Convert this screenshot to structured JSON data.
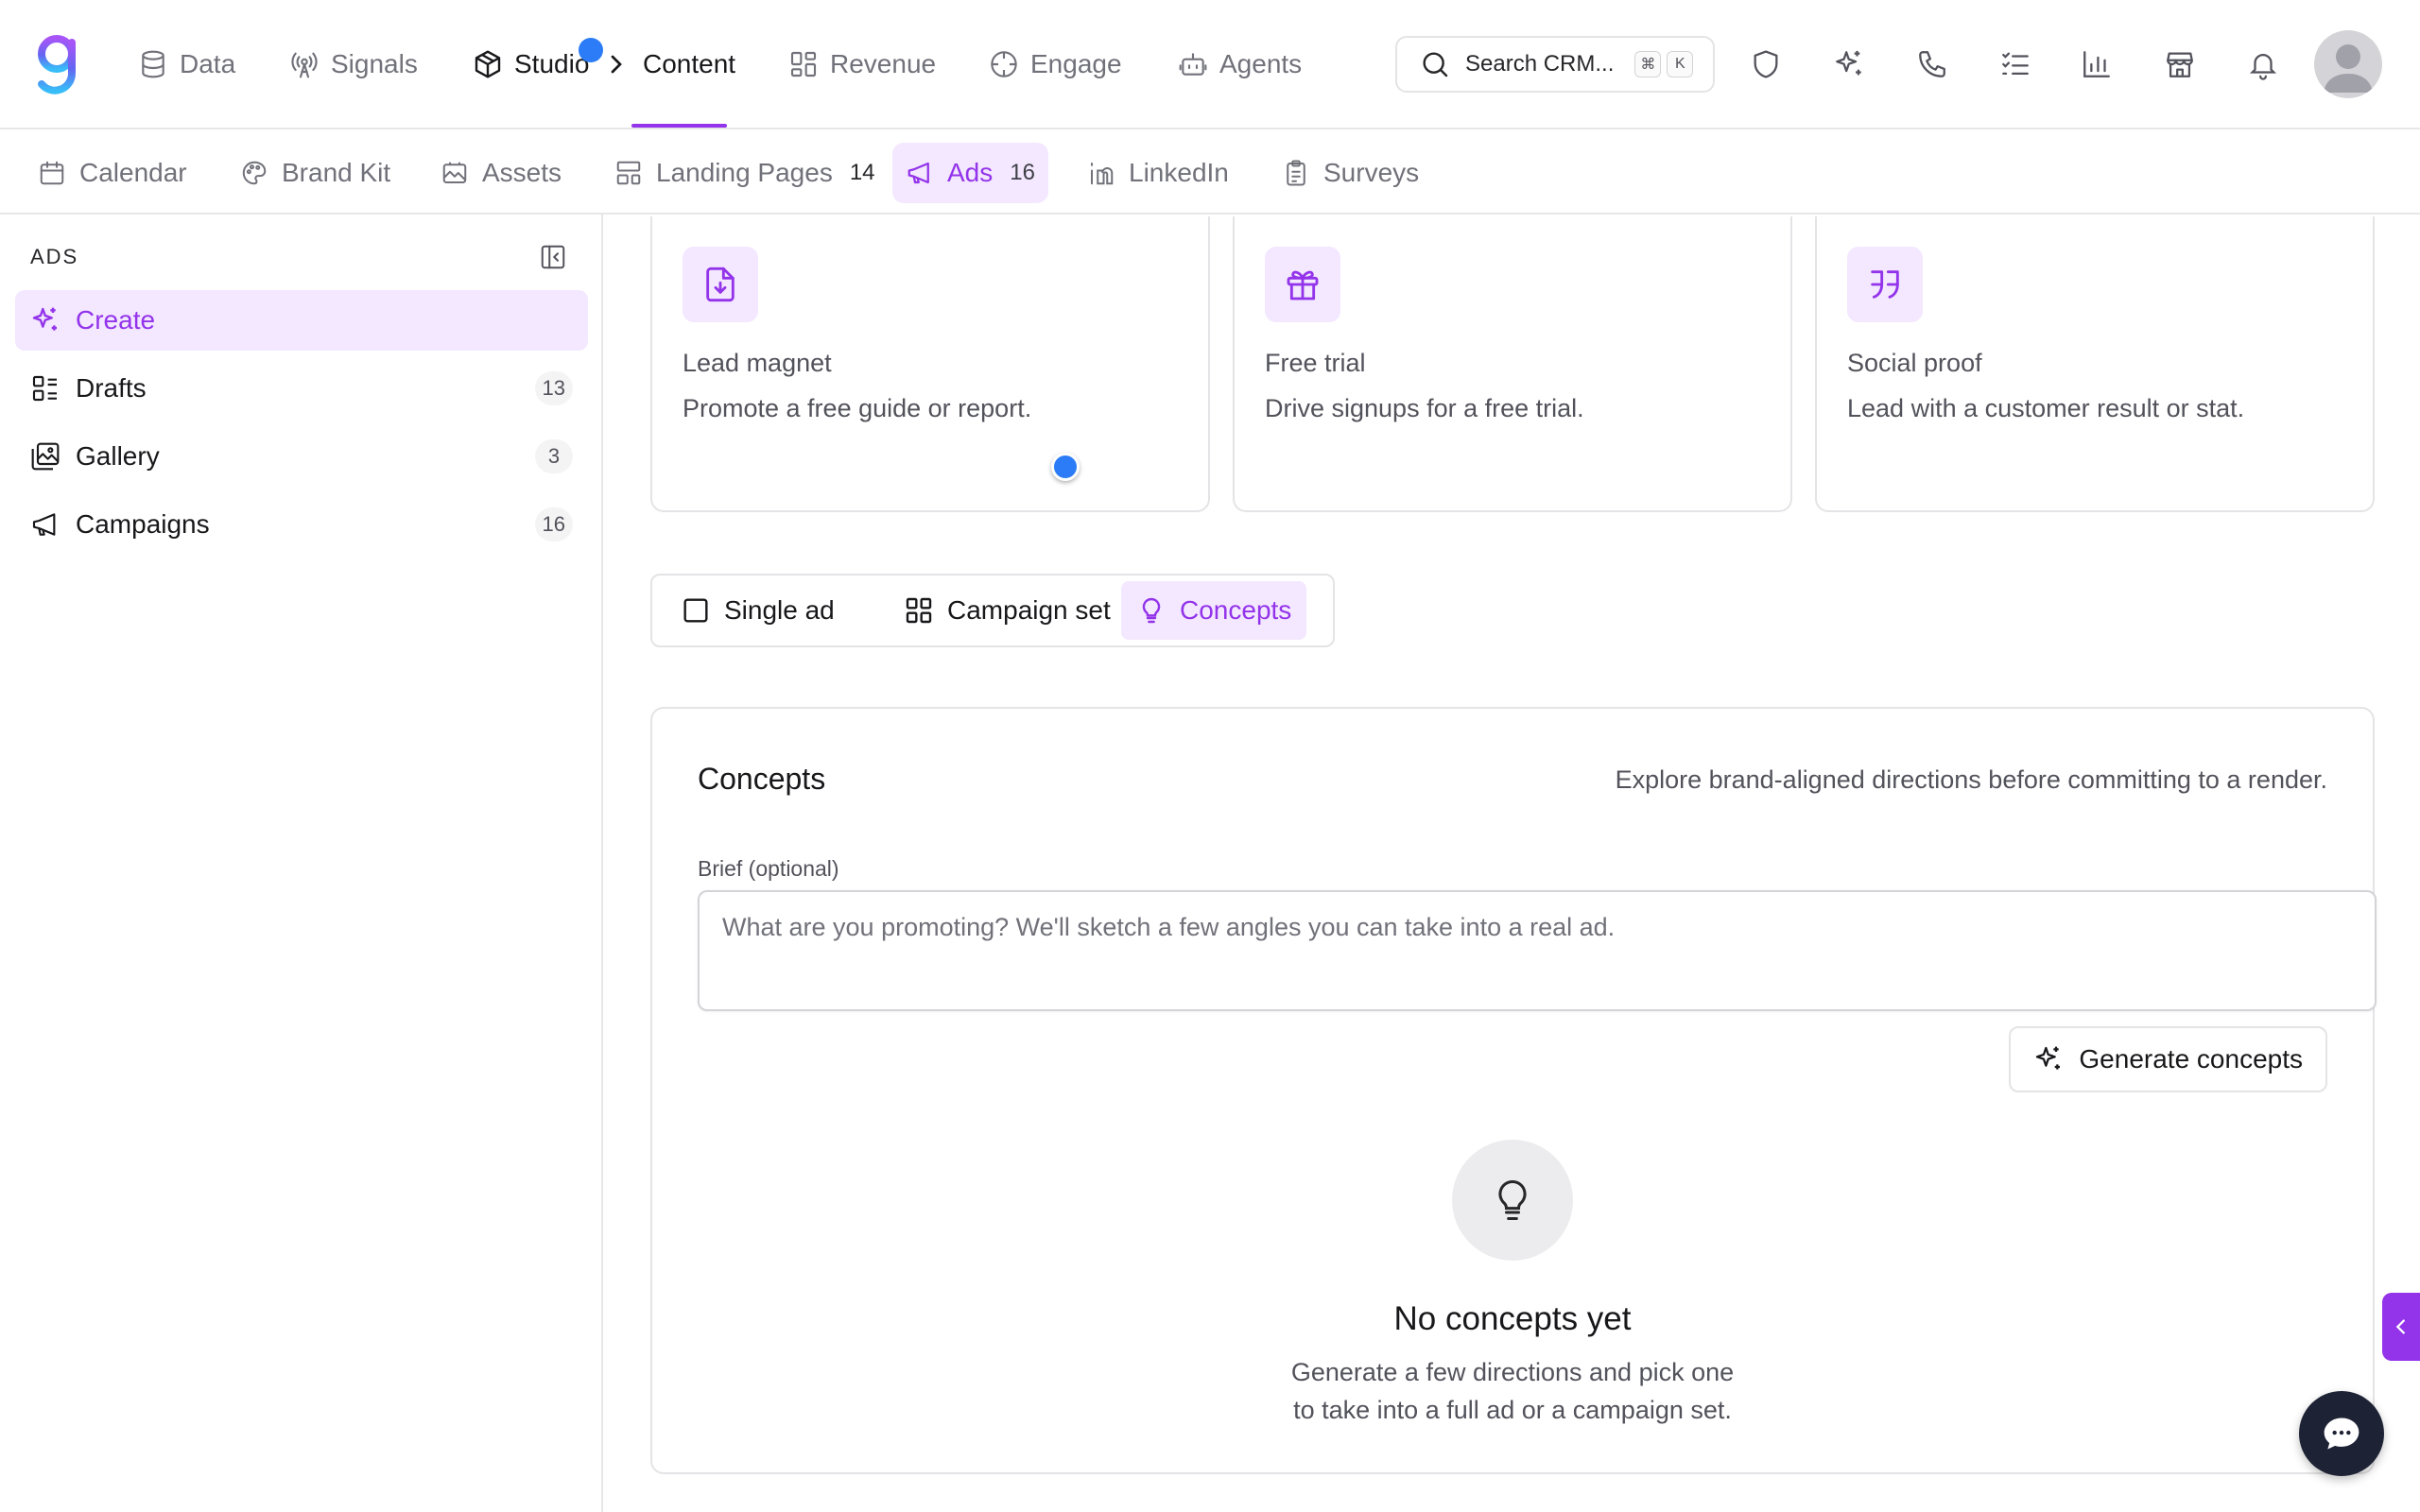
{
  "colors": {
    "accent": "#9333ea",
    "accent_bg": "#f3e8ff",
    "cursor": "#2b7cf6",
    "chat": "#1e2235"
  },
  "topnav": {
    "items": [
      {
        "label": "Data",
        "icon": "database-icon"
      },
      {
        "label": "Signals",
        "icon": "broadcast-icon"
      },
      {
        "label": "Studio",
        "icon": "package-icon"
      },
      {
        "label": "Content",
        "icon": "chevron-right-icon"
      },
      {
        "label": "Revenue",
        "icon": "grid-icon"
      },
      {
        "label": "Engage",
        "icon": "crosshair-icon"
      },
      {
        "label": "Agents",
        "icon": "bot-icon"
      }
    ],
    "search": {
      "placeholder": "Search CRM...",
      "shortcut_mod": "⌘",
      "shortcut_key": "K"
    },
    "icons": [
      "shield-icon",
      "sparkles-icon",
      "phone-icon",
      "checklist-icon",
      "bar-chart-icon",
      "store-icon",
      "bell-icon"
    ]
  },
  "subnav": {
    "items": [
      {
        "label": "Calendar",
        "icon": "calendar-icon"
      },
      {
        "label": "Brand Kit",
        "icon": "palette-icon"
      },
      {
        "label": "Assets",
        "icon": "image-folder-icon"
      },
      {
        "label": "Landing Pages",
        "count": "14",
        "icon": "layout-icon"
      },
      {
        "label": "Ads",
        "count": "16",
        "icon": "megaphone-icon",
        "active": true
      },
      {
        "label": "LinkedIn",
        "icon": "linkedin-icon"
      },
      {
        "label": "Surveys",
        "icon": "clipboard-icon"
      }
    ]
  },
  "sidebar": {
    "title": "ADS",
    "items": [
      {
        "label": "Create",
        "icon": "sparkles-icon",
        "active": true
      },
      {
        "label": "Drafts",
        "count": "13",
        "icon": "list-icon"
      },
      {
        "label": "Gallery",
        "count": "3",
        "icon": "gallery-icon"
      },
      {
        "label": "Campaigns",
        "count": "16",
        "icon": "megaphone-icon"
      }
    ]
  },
  "templates": [
    {
      "title": "Lead magnet",
      "description": "Promote a free guide or report.",
      "icon": "file-download-icon"
    },
    {
      "title": "Free trial",
      "description": "Drive signups for a free trial.",
      "icon": "gift-icon"
    },
    {
      "title": "Social proof",
      "description": "Lead with a customer result or stat.",
      "icon": "quote-icon"
    }
  ],
  "modes": [
    {
      "label": "Single ad",
      "icon": "square-icon"
    },
    {
      "label": "Campaign set",
      "icon": "grid-icon"
    },
    {
      "label": "Concepts",
      "icon": "lightbulb-icon",
      "active": true
    }
  ],
  "concepts": {
    "title": "Concepts",
    "subtitle": "Explore brand-aligned directions before committing to a render.",
    "brief_label": "Brief (optional)",
    "brief_placeholder": "What are you promoting? We'll sketch a few angles you can take into a real ad.",
    "brief_value": "",
    "generate_label": "Generate concepts",
    "empty_title": "No concepts yet",
    "empty_line1": "Generate a few directions and pick one",
    "empty_line2": "to take into a full ad or a campaign set."
  }
}
